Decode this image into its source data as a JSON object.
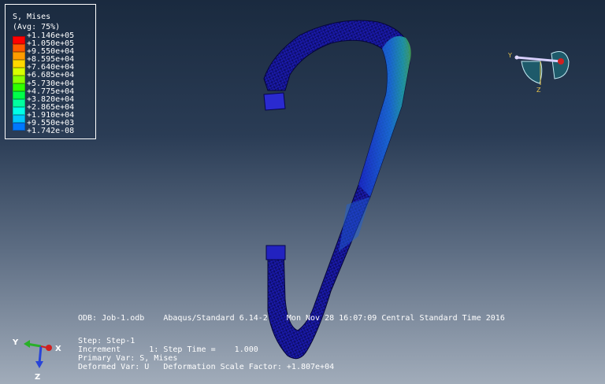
{
  "legend": {
    "title": "S, Mises",
    "subtitle": "(Avg: 75%)",
    "entries": [
      {
        "value": "+1.146e+05",
        "color": "#ff0000"
      },
      {
        "value": "+1.050e+05",
        "color": "#ff5a00"
      },
      {
        "value": "+9.550e+04",
        "color": "#ff9c00"
      },
      {
        "value": "+8.595e+04",
        "color": "#ffd800"
      },
      {
        "value": "+7.640e+04",
        "color": "#d8ff00"
      },
      {
        "value": "+6.685e+04",
        "color": "#8cff00"
      },
      {
        "value": "+5.730e+04",
        "color": "#30ff00"
      },
      {
        "value": "+4.775e+04",
        "color": "#00ff4a"
      },
      {
        "value": "+3.820e+04",
        "color": "#00ffa0"
      },
      {
        "value": "+2.865e+04",
        "color": "#00ffe8"
      },
      {
        "value": "+1.910e+04",
        "color": "#00c8ff"
      },
      {
        "value": "+9.550e+03",
        "color": "#0078ff"
      },
      {
        "value": "+1.742e-08",
        "color": "#0018ff"
      }
    ]
  },
  "info": {
    "odb_line": "ODB: Job-1.odb    Abaqus/Standard 6.14-2    Mon Nov 28 16:07:09 Central Standard Time 2016",
    "step": "Step: Step-1",
    "increment": "Increment      1: Step Time =    1.000",
    "primary": "Primary Var: S, Mises",
    "deformed": "Deformed Var: U   Deformation Scale Factor: +1.807e+04"
  },
  "triad": {
    "y": "Y",
    "x": "X",
    "z": "Z"
  },
  "mini_triad": {
    "y": "Y",
    "z": "Z"
  }
}
